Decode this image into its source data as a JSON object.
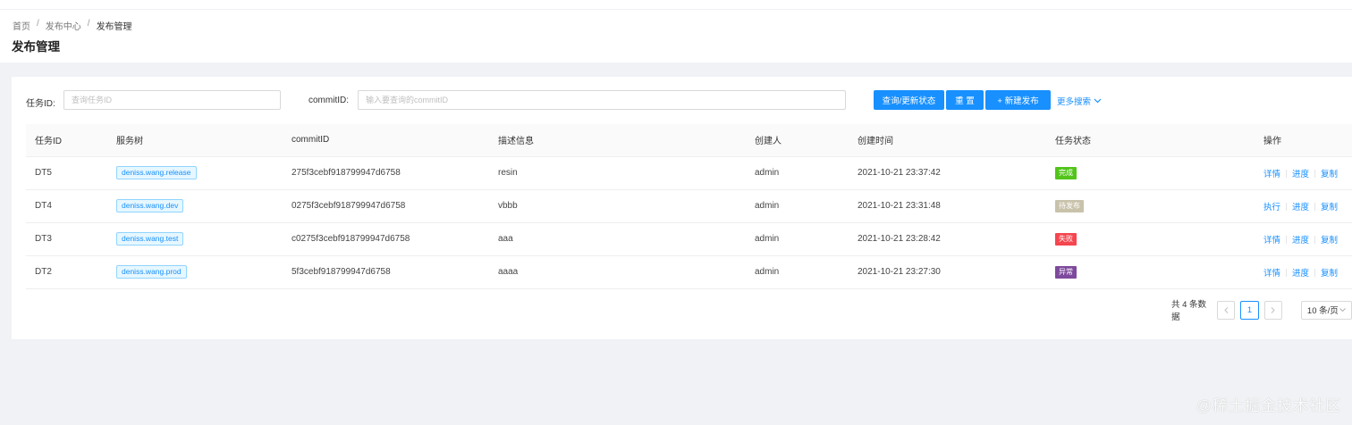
{
  "breadcrumb": {
    "home": "首页",
    "center": "发布中心",
    "current": "发布管理",
    "sep": "/"
  },
  "page_title": "发布管理",
  "filters": {
    "task_id_label": "任务ID:",
    "task_id_placeholder": "查询任务ID",
    "commit_id_label": "commitID:",
    "commit_id_placeholder": "输入要查询的commitID"
  },
  "buttons": {
    "query": "查询/更新状态",
    "reset": "重 置",
    "new_release": "+ 新建发布",
    "more_search": "更多搜索"
  },
  "table": {
    "headers": [
      "任务ID",
      "服务树",
      "commitID",
      "描述信息",
      "创建人",
      "创建时间",
      "任务状态",
      "操作"
    ],
    "rows": [
      {
        "id": "DT5",
        "tree": "deniss.wang.release",
        "commit": "275f3cebf918799947d6758",
        "desc": "resin",
        "creator": "admin",
        "time": "2021-10-21 23:37:42",
        "status": "完成",
        "action1": "详情",
        "action2": "进度",
        "action3": "复制"
      },
      {
        "id": "DT4",
        "tree": "deniss.wang.dev",
        "commit": "0275f3cebf918799947d6758",
        "desc": "vbbb",
        "creator": "admin",
        "time": "2021-10-21 23:31:48",
        "status": "待发布",
        "action1": "执行",
        "action2": "进度",
        "action3": "复制"
      },
      {
        "id": "DT3",
        "tree": "deniss.wang.test",
        "commit": "c0275f3cebf918799947d6758",
        "desc": "aaa",
        "creator": "admin",
        "time": "2021-10-21 23:28:42",
        "status": "失败",
        "action1": "详情",
        "action2": "进度",
        "action3": "复制"
      },
      {
        "id": "DT2",
        "tree": "deniss.wang.prod",
        "commit": "5f3cebf918799947d6758",
        "desc": "aaaa",
        "creator": "admin",
        "time": "2021-10-21 23:27:30",
        "status": "异常",
        "action1": "详情",
        "action2": "进度",
        "action3": "复制"
      }
    ]
  },
  "status_colors": {
    "完成": "#52c41a",
    "待发布": "#c9c2ab",
    "失败": "#f5464f",
    "异常": "#7e4a9d"
  },
  "colors": {
    "primary": "#1890ff"
  },
  "pagination": {
    "total": "共 4 条数据",
    "current": "1",
    "page_size": "10 条/页"
  },
  "watermark": "@稀土掘金技术社区"
}
